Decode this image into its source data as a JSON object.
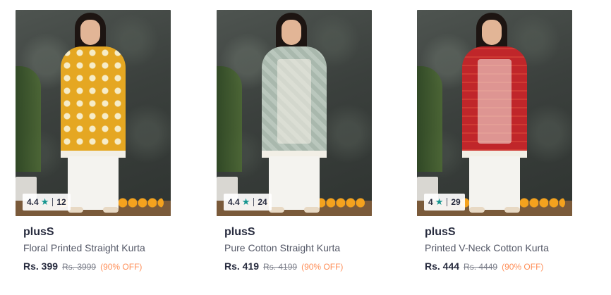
{
  "products": [
    {
      "brand": "plusS",
      "title": "Floral Printed Straight Kurta",
      "rating": "4.4",
      "rating_count": "12",
      "price": "Rs. 399",
      "mrp": "Rs. 3999",
      "discount": "(90% OFF)",
      "kurta_color": "#e5a722"
    },
    {
      "brand": "plusS",
      "title": "Pure Cotton Straight Kurta",
      "rating": "4.4",
      "rating_count": "24",
      "price": "Rs. 419",
      "mrp": "Rs. 4199",
      "discount": "(90% OFF)",
      "kurta_color": "#a9b8ad"
    },
    {
      "brand": "plusS",
      "title": "Printed V-Neck Cotton Kurta",
      "rating": "4",
      "rating_count": "29",
      "price": "Rs. 444",
      "mrp": "Rs. 4449",
      "discount": "(90% OFF)",
      "kurta_color": "#c0262a"
    }
  ],
  "icons": {
    "rating_star": "star-icon"
  },
  "colors": {
    "star": "#14958f",
    "discount": "#ff905a",
    "text": "#282c3f",
    "subtext": "#535766"
  }
}
